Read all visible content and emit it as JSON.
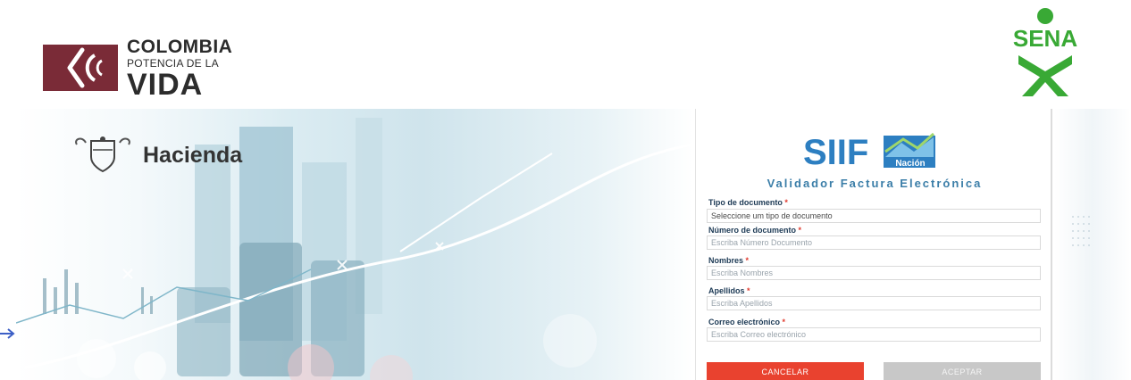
{
  "header": {
    "colombia_logo": {
      "line1": "COLOMBIA",
      "line2": "POTENCIA DE LA",
      "line3": "VIDA"
    },
    "sena_logo": {
      "text": "SENA",
      "color": "#39a935"
    }
  },
  "hero": {
    "title": "Hacienda",
    "shield_icon": "colombia-coat-of-arms-icon"
  },
  "form": {
    "logo_text": "SIIF",
    "logo_subtext": "Nación",
    "title": "Validador Factura Electrónica",
    "fields": [
      {
        "label": "Tipo de documento",
        "required": "*",
        "value": "Seleccione um tipo de documento"
      },
      {
        "label": "Número de documento",
        "required": "*",
        "placeholder": "Escriba Número Documento"
      },
      {
        "label": "Nombres",
        "required": "*",
        "placeholder": "Escriba Nombres"
      },
      {
        "label": "Apellidos",
        "required": "*",
        "placeholder": "Escriba Apellidos"
      },
      {
        "label": "Correo electrónico",
        "required": "*",
        "placeholder": "Escriba Correo electrónico"
      }
    ],
    "buttons": {
      "cancel": "CANCELAR",
      "accept": "ACEPTAR"
    }
  },
  "colors": {
    "cancel": "#e9422f",
    "accept_disabled": "#c8c8c8",
    "title_blue": "#3b7ea8",
    "colombia_brand": "#7a2b37"
  }
}
